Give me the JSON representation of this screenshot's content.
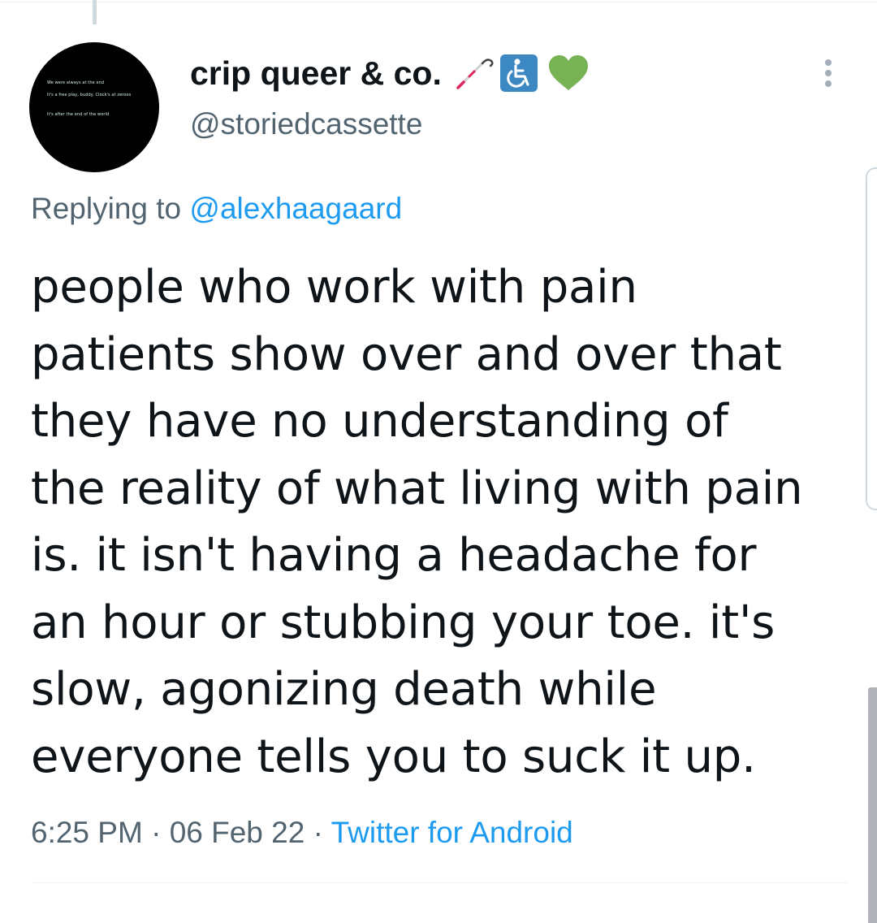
{
  "header": {
    "display_name": "crip queer & co.",
    "handle": "@storiedcassette",
    "name_icons": [
      "cane-icon",
      "wheelchair-icon",
      "green-heart-icon"
    ],
    "more_icon": "more-vertical-icon",
    "avatar_text": [
      "We were always at the end",
      "It's a free play, buddy. Clock's at zeroes",
      "It's after the end of the world"
    ]
  },
  "reply": {
    "prefix": "Replying to",
    "handle": "@alexhaagaard"
  },
  "tweet": {
    "lines": [
      "people who work with pain",
      "patients show over and over that",
      "they have no understanding of",
      "the reality of what living with pain",
      "is. it isn't having a headache for",
      "an hour or stubbing your toe. it's",
      "slow, agonizing death while",
      "everyone tells you to suck it up."
    ]
  },
  "meta": {
    "time": "6:25 PM",
    "separator": "·",
    "date": "06 Feb 22",
    "source": "Twitter for Android"
  },
  "colors": {
    "text_primary": "#0f1419",
    "text_secondary": "#536471",
    "link": "#1d9bf0",
    "heart": "#77b255",
    "wheelchair_bg": "#3b88c3"
  }
}
